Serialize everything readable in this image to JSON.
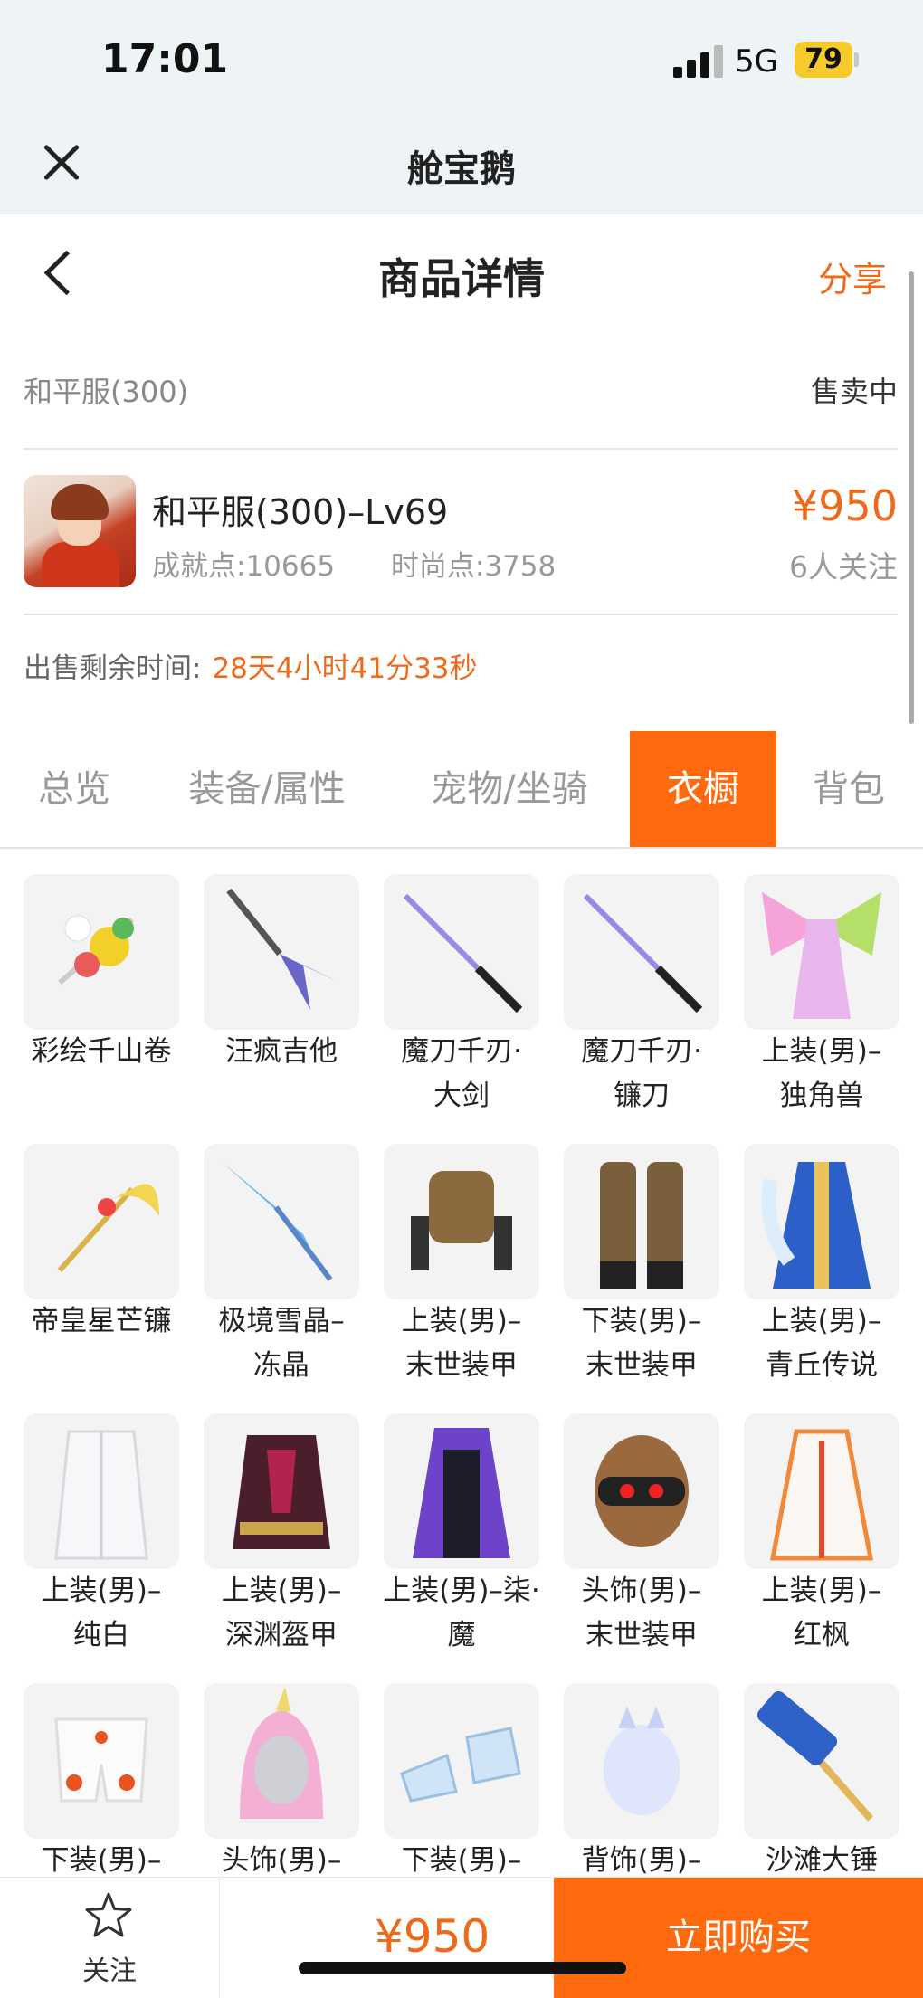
{
  "status_bar": {
    "time": "17:01",
    "network": "5G",
    "battery": "79"
  },
  "miniapp": {
    "title": "舱宝鹅"
  },
  "header": {
    "title": "商品详情",
    "share": "分享"
  },
  "listing": {
    "server": "和平服(300)",
    "status": "售卖中",
    "account_title": "和平服(300)–Lv69",
    "achievement": "成就点:10665",
    "fashion": "时尚点:3758",
    "price": "¥950",
    "watchers": "6人关注",
    "remaining_label": "出售剩余时间:",
    "remaining_value": "28天4小时41分33秒"
  },
  "tabs": [
    {
      "label": "总览",
      "active": false
    },
    {
      "label": "装备/属性",
      "active": false
    },
    {
      "label": "宠物/坐骑",
      "active": false
    },
    {
      "label": "衣橱",
      "active": true
    },
    {
      "label": "背包",
      "active": false
    }
  ],
  "wardrobe_items": [
    {
      "label": "彩绘千山卷",
      "icon": "scroll-weapon-icon"
    },
    {
      "label": "汪疯吉他",
      "icon": "guitar-icon"
    },
    {
      "label": "魔刀千刃·大剑",
      "icon": "katana-icon"
    },
    {
      "label": "魔刀千刃·镰刀",
      "icon": "katana-icon"
    },
    {
      "label": "上装(男)–独角兽",
      "icon": "winged-dress-icon"
    },
    {
      "label": "帝皇星芒镰",
      "icon": "scythe-icon"
    },
    {
      "label": "极境雪晶–冻晶",
      "icon": "ice-spear-icon"
    },
    {
      "label": "上装(男)–末世装甲",
      "icon": "armor-top-icon"
    },
    {
      "label": "下装(男)–末世装甲",
      "icon": "armor-legs-icon"
    },
    {
      "label": "上装(男)–青丘传说",
      "icon": "blue-robe-icon"
    },
    {
      "label": "上装(男)–纯白",
      "icon": "white-coat-icon"
    },
    {
      "label": "上装(男)–深渊盔甲",
      "icon": "abyss-armor-icon"
    },
    {
      "label": "上装(男)–柒·魔",
      "icon": "purple-hoodie-icon"
    },
    {
      "label": "头饰(男)–末世装甲",
      "icon": "helmet-icon"
    },
    {
      "label": "上装(男)–红枫",
      "icon": "red-maple-robe-icon"
    },
    {
      "label": "下装(男)–",
      "icon": "maple-shorts-icon"
    },
    {
      "label": "头饰(男)–",
      "icon": "unicorn-hood-icon"
    },
    {
      "label": "下装(男)–",
      "icon": "boots-icon"
    },
    {
      "label": "背饰(男)–",
      "icon": "back-ornament-icon"
    },
    {
      "label": "沙滩大锤",
      "icon": "hammer-icon"
    }
  ],
  "bottom_bar": {
    "fav_label": "关注",
    "price": "¥950",
    "buy_label": "立即购买"
  },
  "colors": {
    "accent": "#ff6a0e",
    "price": "#ee6a1a",
    "background": "#eef3f6"
  }
}
